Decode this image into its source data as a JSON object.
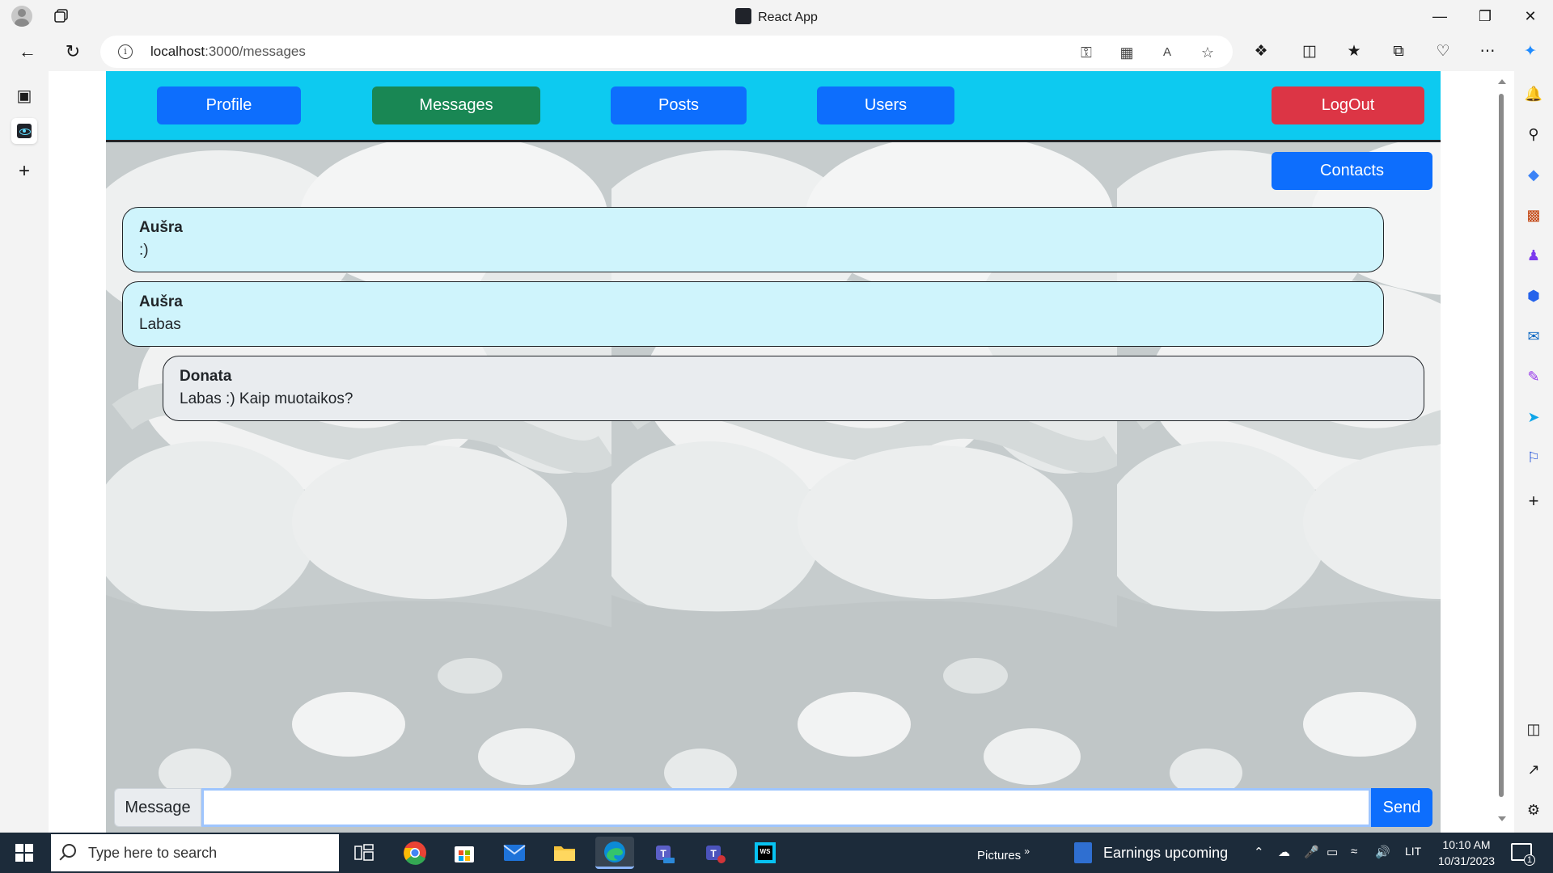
{
  "browser": {
    "window_title": "React App",
    "url_host": "localhost",
    "url_rest": ":3000/messages"
  },
  "nav": {
    "profile": "Profile",
    "messages": "Messages",
    "posts": "Posts",
    "users": "Users",
    "logout": "LogOut"
  },
  "contacts_label": "Contacts",
  "messages": [
    {
      "author": "Aušra",
      "text": ":)",
      "side": "other"
    },
    {
      "author": "Aušra",
      "text": "Labas",
      "side": "other"
    },
    {
      "author": "Donata",
      "text": "Labas :) Kaip muotaikos?",
      "side": "mine"
    }
  ],
  "composer": {
    "label": "Message",
    "value": "",
    "send_label": "Send"
  },
  "colors": {
    "navbar": "#0dcaf0",
    "primary": "#0d6efd",
    "success": "#198754",
    "danger": "#dc3545",
    "bubble_other": "#cff4fc",
    "bubble_mine": "#e9ecef"
  },
  "taskbar": {
    "search_placeholder": "Type here to search",
    "pictures": "Pictures",
    "news": "Earnings upcoming",
    "language": "LIT",
    "time": "10:10 AM",
    "date": "10/31/2023",
    "notifications": "1"
  }
}
